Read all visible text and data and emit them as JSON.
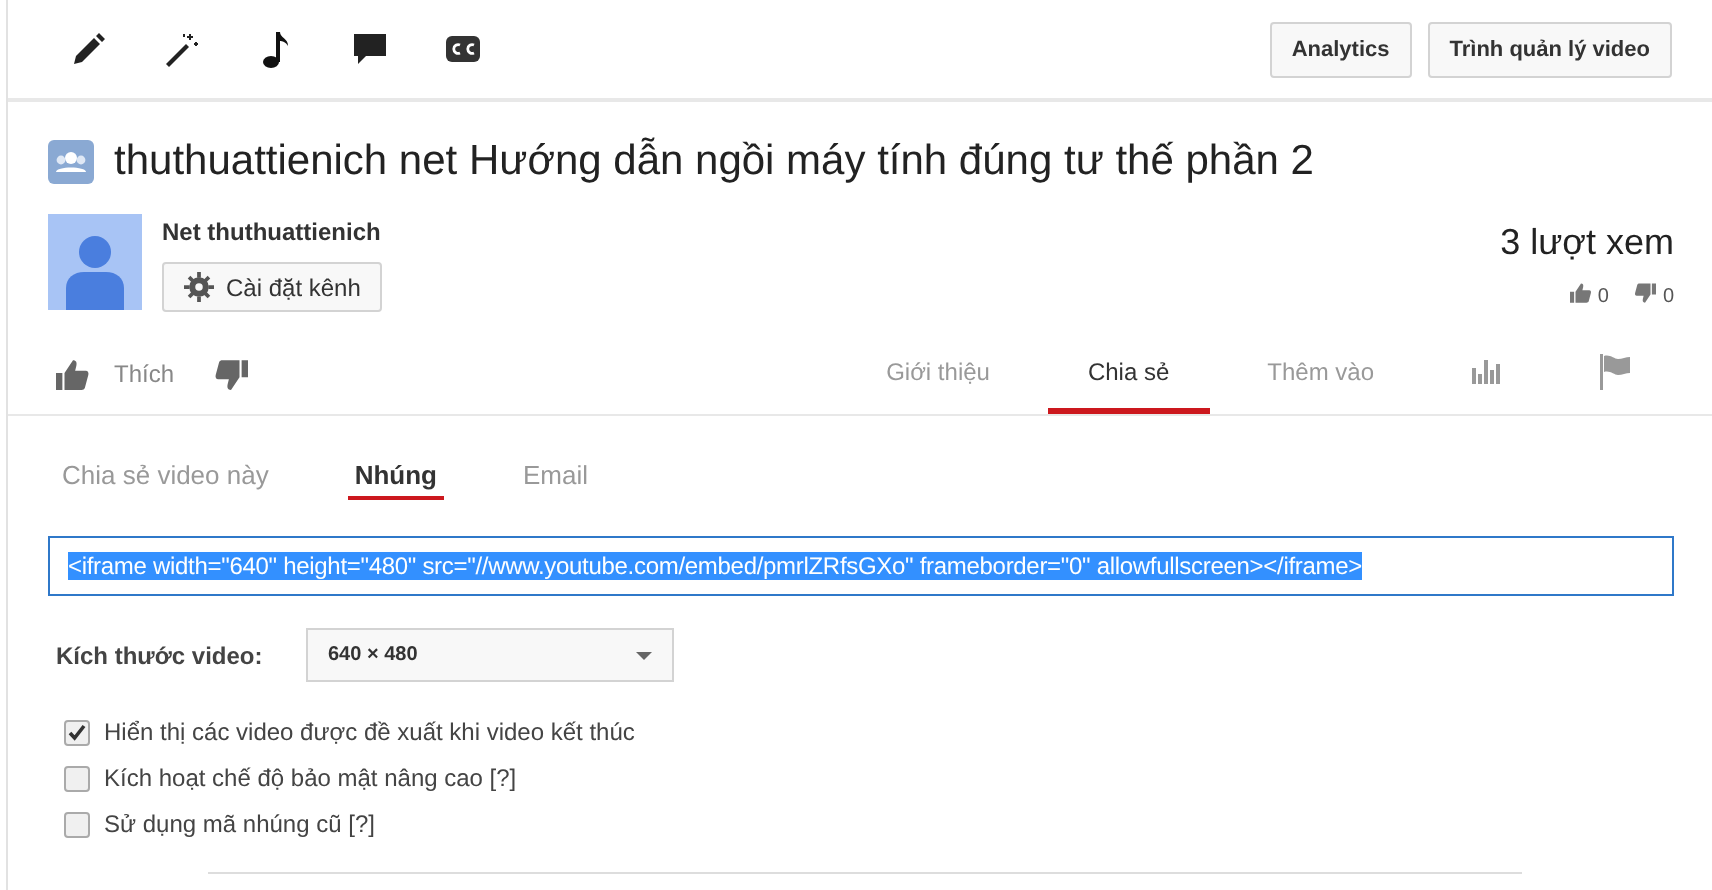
{
  "toolbar": {
    "tools": [
      {
        "kind": "pencil"
      },
      {
        "kind": "wand"
      },
      {
        "kind": "music"
      },
      {
        "kind": "comment"
      },
      {
        "kind": "cc"
      }
    ],
    "buttons": [
      "Analytics",
      "Trình quản lý video"
    ]
  },
  "video": {
    "title": "thuthuattienich net Hướng dẫn ngồi máy tính đúng tư thế phần 2",
    "channel": "Net thuthuattienich",
    "channel_settings": "Cài đặt kênh",
    "views": "3 lượt xem",
    "likes": "0",
    "dislikes": "0"
  },
  "actions": {
    "like": "Thích",
    "tabs": [
      {
        "kind": "text",
        "label": "Giới thiệu",
        "selected": false
      },
      {
        "kind": "text",
        "label": "Chia sẻ",
        "selected": true
      },
      {
        "kind": "text",
        "label": "Thêm vào",
        "selected": false
      },
      {
        "kind": "stats",
        "selected": false
      },
      {
        "kind": "flag",
        "selected": false
      }
    ]
  },
  "share": {
    "tabs": [
      {
        "label": "Chia sẻ video này",
        "selected": false
      },
      {
        "label": "Nhúng",
        "selected": true
      },
      {
        "label": "Email",
        "selected": false
      }
    ],
    "embed_code": "<iframe width=\"640\" height=\"480\" src=\"//www.youtube.com/embed/pmrlZRfsGXo\" frameborder=\"0\" allowfullscreen></iframe>",
    "size_label": "Kích thước video:",
    "size_value": "640 × 480",
    "options": [
      {
        "label": "Hiển thị các video được đề xuất khi video kết thúc",
        "checked": true
      },
      {
        "label": "Kích hoạt chế độ bảo mật nâng cao [?]",
        "checked": false
      },
      {
        "label": "Sử dụng mã nhúng cũ [?]",
        "checked": false
      }
    ]
  }
}
